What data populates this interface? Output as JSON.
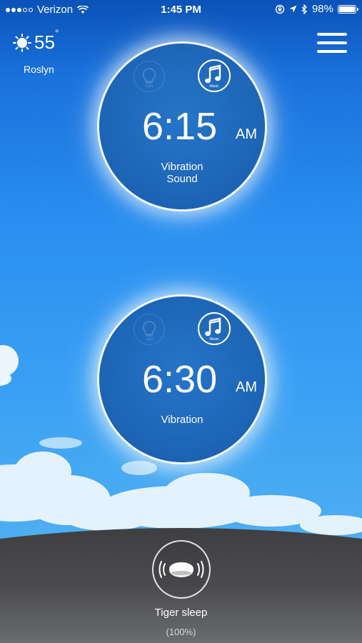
{
  "status_bar": {
    "carrier": "Verizon",
    "time": "1:45 PM",
    "battery": "98%",
    "battery_level": 0.98,
    "signal_dots": [
      true,
      true,
      true,
      false,
      false
    ],
    "icons": [
      "wifi-icon",
      "lock-rotation-icon",
      "location-arrow-icon",
      "bluetooth-icon",
      "battery-icon"
    ]
  },
  "weather": {
    "temperature": "55",
    "degree_symbol": "°",
    "city": "Roslyn",
    "icon": "sun-icon"
  },
  "menu": {
    "icon": "hamburger-menu-icon"
  },
  "alarms": [
    {
      "hour_min": "6:15",
      "ampm": "AM",
      "modes": [
        "Vibration",
        "Sound"
      ],
      "light_label": "Light",
      "music_label": "Music",
      "light_enabled": false,
      "music_enabled": true
    },
    {
      "hour_min": "6:30",
      "ampm": "AM",
      "modes": [
        "Vibration"
      ],
      "light_label": "Light",
      "music_label": "Music",
      "light_enabled": false,
      "music_enabled": true
    }
  ],
  "device": {
    "name": "Tiger sleep",
    "percent": "(100%)",
    "icon": "sleep-device-icon"
  },
  "colors": {
    "sky_top": "#0a52b8",
    "sky_bottom": "#62b8ee",
    "alarm_circle": "#1e66b7",
    "dome": "#4a4a4d"
  }
}
